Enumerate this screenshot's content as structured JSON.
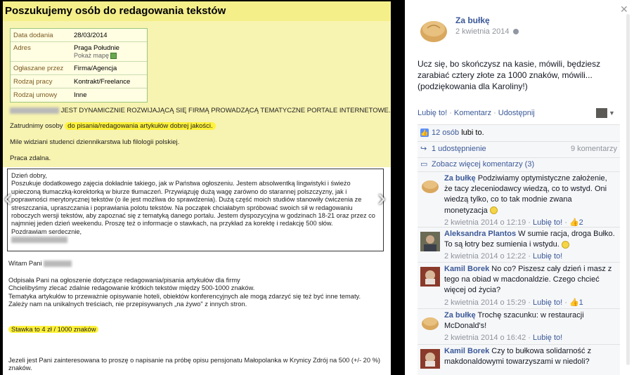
{
  "photo": {
    "title": "Poszukujemy osób do redagowania tekstów",
    "details": [
      {
        "label": "Data dodania",
        "value": "28/03/2014"
      },
      {
        "label": "Adres",
        "value": "Praga Południe"
      },
      {
        "label": "Ogłaszane przez",
        "value": "Firma/Agencja"
      },
      {
        "label": "Rodzaj pracy",
        "value": "Kontrakt/Freelance"
      },
      {
        "label": "Rodzaj umowy",
        "value": "Inne"
      }
    ],
    "map_link": "Pokaż mapę",
    "ad_intro": "JEST DYNAMICZNIE ROZWIJAJĄCĄ SIĘ FIRMĄ PROWADZĄCĄ TEMATYCZNE PORTALE INTERNETOWE.",
    "ad_hire_prefix": "Zatrudnimy osoby",
    "ad_hire_highlight": "do pisania/redagowania  artykułów dobrej jakości.",
    "ad_students": "Mile widziani studenci dziennikarstwa lub filologii polskiej.",
    "ad_remote": "Praca zdalna.",
    "letter": "Dzień dobry,\nPoszukuje dodatkowego zajęcia dokładnie takiego, jak w Państwa ogłoszeniu. Jestem absolwentką lingwistyki i świeżo upieczoną tłumaczką-korektorką w biurze tłumaczeń. Przywiązuję dużą wagę zarówno do starannej polszczyzny, jak i poprawności merytorycznej tekstów (o ile jest możliwa do sprawdzenia). Dużą część moich studiów stanowiły ćwiczenia ze streszczania, upraszczania i poprawiania polotu tekstów. Na początek chciałabym spróbować swoich sił w redagowaniu roboczych wersji tekstów, aby zapoznać się z tematyką danego portalu. Jestem dyspozycyjna w godzinach 18-21 oraz przez co najmniej jeden dzień weekendu. Proszę też o informacje o stawkach, na przykład za korektę i redakcję 500 słów.\nPozdrawiam serdecznie,",
    "reply_greeting": "Witam Pani",
    "reply_body": "Odpisała Pani na ogłoszenie dotyczące redagowania/pisania artykułów dla firmy\n Chcielibyśmy zlecać zdalnie redagowanie krótkich tekstów między 500-1000 znaków.\nTematyka artykułów to przeważnie opisywanie hoteli, obiektów konferencyjnych ale mogą zdarzyć się też być inne tematy.\nZależy nam na unikalnych treściach, nie przepisywanych „na żywo\" z innych stron.",
    "reply_rate": "Stawka to 4 zł / 1000 znaków",
    "reply_offer": "Jezeli jest Pani zainteresowana to proszę o napisanie na próbę opisu pensjonatu Małopolanka w Krynicy Zdrój na 500 (+/- 20 %) znaków."
  },
  "panel": {
    "page_name": "Za bułkę",
    "post_date": "2 kwietnia 2014",
    "post_text": "Ucz się, bo skończysz na kasie, mówili, będziesz zarabiać cztery złote za 1000 znaków, mówili... (podziękowania dla Karoliny!)",
    "action_like": "Lubię to!",
    "action_comment": "Komentarz",
    "action_share": "Udostępnij",
    "likes": "12 osób",
    "likes_suffix": "lubi to.",
    "shares": "1 udostępnienie",
    "comment_count": "9 komentarzy",
    "more_comments": "Zobacz więcej komentarzy (3)",
    "comments": [
      {
        "author": "Za bułkę",
        "text": "Podziwiamy optymistyczne założenie, że tacy zleceniodawcy wiedzą, co to wstyd. Oni wiedzą tylko, co to tak modnie zwana monetyzacja",
        "date": "2 kwietnia 2014 o 12:19",
        "like": "Lubię to!",
        "likes": "2"
      },
      {
        "author": "Aleksandra Plantos",
        "text": "W sumie racja, droga Bułko. To są łotry bez sumienia i wstydu.",
        "date": "2 kwietnia 2014 o 12:22",
        "like": "Lubię to!",
        "likes": ""
      },
      {
        "author": "Kamil Borek",
        "text": "No co? Piszesz cały dzień i masz z tego na obiad w macdonaldzie. Czego chcieć więcej od życia?",
        "date": "2 kwietnia 2014 o 15:29",
        "like": "Lubię to!",
        "likes": "1"
      },
      {
        "author": "Za bułkę",
        "text": "Trochę szacunku: w restauracji McDonald's!",
        "date": "2 kwietnia 2014 o 16:42",
        "like": "Lubię to!",
        "likes": ""
      },
      {
        "author": "Kamil Borek",
        "text": "Czy to bułkowa solidarność z makdonaldowymi towarzyszami w niedoli?",
        "date": "",
        "like": "",
        "likes": ""
      }
    ]
  }
}
